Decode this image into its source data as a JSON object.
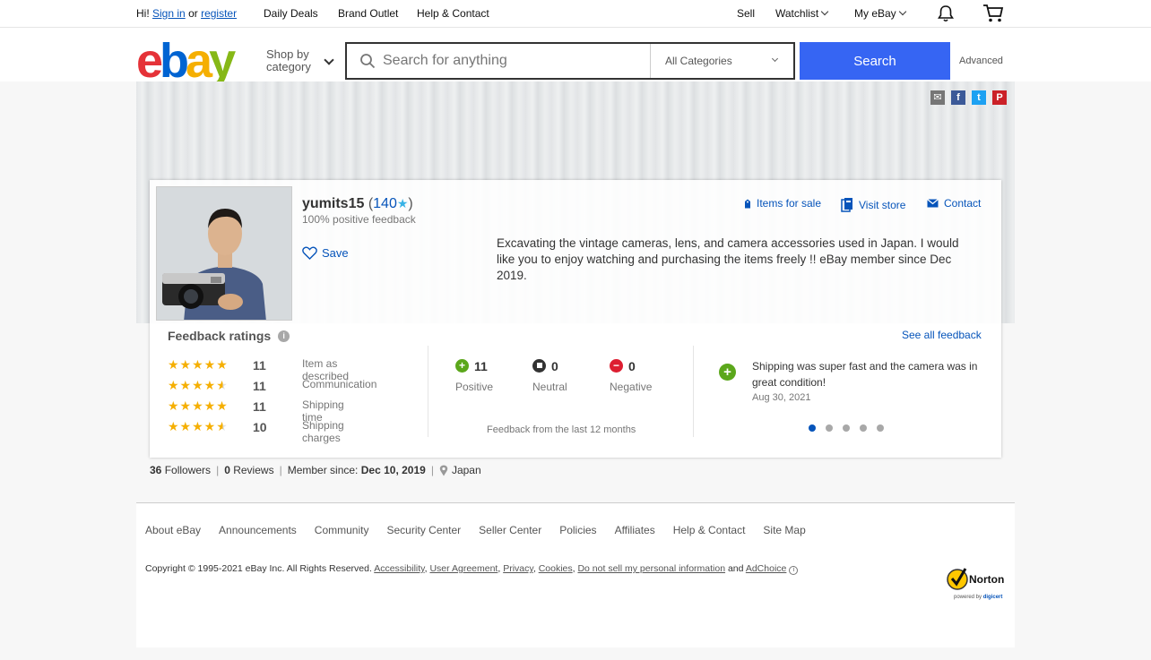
{
  "topbar": {
    "greeting": "Hi!",
    "sign_in": "Sign in",
    "or": "or",
    "register": "register",
    "daily_deals": "Daily Deals",
    "brand_outlet": "Brand Outlet",
    "help_contact": "Help & Contact",
    "sell": "Sell",
    "watchlist": "Watchlist",
    "my_ebay": "My eBay"
  },
  "header": {
    "logo_letters": [
      "e",
      "b",
      "a",
      "y"
    ],
    "shop_by_line1": "Shop by",
    "shop_by_line2": "category",
    "search_placeholder": "Search for anything",
    "category": "All Categories",
    "search_button": "Search",
    "advanced": "Advanced"
  },
  "profile": {
    "username": "yumits15",
    "score": "140",
    "positive": "100% positive feedback",
    "save": "Save",
    "actions": [
      "Items for sale",
      "Visit store",
      "Contact"
    ],
    "bio": "Excavating the vintage cameras, lens, and camera accessories used in Japan. I would like you to enjoy watching and purchasing the items freely !! eBay member since Dec 2019."
  },
  "feedback": {
    "title": "Feedback ratings",
    "see_all": "See all feedback",
    "ratings": [
      {
        "stars": 5,
        "count": "11",
        "label": "Item as described"
      },
      {
        "stars": 4.5,
        "count": "11",
        "label": "Communication"
      },
      {
        "stars": 5,
        "count": "11",
        "label": "Shipping time"
      },
      {
        "stars": 4.5,
        "count": "10",
        "label": "Shipping charges"
      }
    ],
    "summary": [
      {
        "count": "11",
        "label": "Positive",
        "color": "#5ba71b",
        "symbol": "+"
      },
      {
        "count": "0",
        "label": "Neutral",
        "color": "#333333",
        "symbol": "■"
      },
      {
        "count": "0",
        "label": "Negative",
        "color": "#dd1e31",
        "symbol": "−"
      }
    ],
    "period": "Feedback from the last 12 months",
    "comment": "Shipping was super fast and the camera was in great condition!",
    "comment_date": "Aug 30, 2021",
    "carousel_pages": 5,
    "carousel_active": 1
  },
  "stats": {
    "followers_count": "36",
    "followers_label": "Followers",
    "reviews_count": "0",
    "reviews_label": "Reviews",
    "member_since_label": "Member since:",
    "member_since": "Dec 10, 2019",
    "location": "Japan"
  },
  "footer": {
    "links": [
      "About eBay",
      "Announcements",
      "Community",
      "Security Center",
      "Seller Center",
      "Policies",
      "Affiliates",
      "Help & Contact",
      "Site Map"
    ],
    "copyright_prefix": "Copyright © 1995-2021 eBay Inc. All Rights Reserved.",
    "legal_links": [
      "Accessibility",
      "User Agreement",
      "Privacy",
      "Cookies",
      "Do not sell my personal information"
    ],
    "and": "and",
    "adchoice": "AdChoice",
    "norton": "Norton",
    "norton_sub_prefix": "powered by",
    "norton_sub_brand": "digicert"
  },
  "colors": {
    "accent": "#3665f3",
    "link": "#0654ba",
    "star": "#f5af02"
  }
}
